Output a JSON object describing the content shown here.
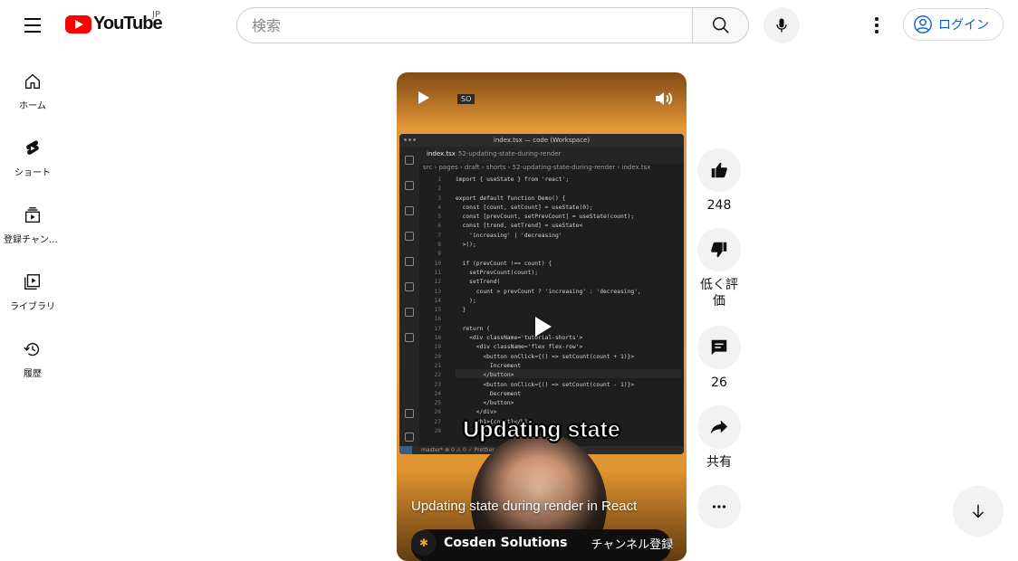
{
  "header": {
    "logo_text": "YouTube",
    "region_code": "JP",
    "search_placeholder": "検索",
    "login_label": "ログイン"
  },
  "guide": {
    "items": [
      {
        "label": "ホーム",
        "icon": "home-icon"
      },
      {
        "label": "ショート",
        "icon": "shorts-icon"
      },
      {
        "label": "登録チャンネル",
        "icon": "subscriptions-icon"
      },
      {
        "label": "ライブラリ",
        "icon": "library-icon"
      },
      {
        "label": "履歴",
        "icon": "history-icon"
      }
    ]
  },
  "player": {
    "so_tag": "SO",
    "overlay_title": "Updating state",
    "video_title": "Updating state during render in React",
    "channel_name": "Cosden Solutions",
    "subscribe_label": "チャンネル登録",
    "editor": {
      "window_title": "index.tsx — code (Workspace)",
      "tab_label": "index.tsx",
      "tab_subtitle": "52-updating-state-during-render",
      "breadcrumb": "src › pages › draft › shorts › 52-updating-state-during-render › index.tsx",
      "status_text": "master*   ⊗ 0 ⚠ 0   ✓ Prettier",
      "line_numbers": [
        "1",
        "2",
        "3",
        "4",
        "5",
        "6",
        "7",
        "8",
        "9",
        "10",
        "11",
        "12",
        "13",
        "14",
        "15",
        "16",
        "17",
        "18",
        "19",
        "20",
        "21",
        "22",
        "23",
        "24",
        "25",
        "26",
        "27",
        "28"
      ],
      "code_lines": [
        "import { useState } from 'react';",
        "",
        "export default function Demo() {",
        "  const [count, setCount] = useState(0);",
        "  const [prevCount, setPrevCount] = useState(count);",
        "  const [trend, setTrend] = useState<",
        "    'increasing' | 'decreasing'",
        "  >();",
        "",
        "  if (prevCount !== count) {",
        "    setPrevCount(count);",
        "    setTrend(",
        "      count > prevCount ? 'increasing' : 'decreasing',",
        "    );",
        "  }",
        "",
        "  return (",
        "    <div className='tutorial-shorts'>",
        "      <div className='flex flex-row'>",
        "        <button onClick={() => setCount(count + 1)}>",
        "          Increment",
        "        </button>",
        "        <button onClick={() => setCount(count - 1)}>",
        "          Decrement",
        "        </button>",
        "      </div>",
        "      <h1>{count}</h1>",
        "      <p>{trend}</p>"
      ]
    }
  },
  "actions": {
    "like_count": "248",
    "dislike_label": "低く評価",
    "comment_count": "26",
    "share_label": "共有"
  },
  "colors": {
    "brand_red": "#ff0000",
    "link_blue": "#065fd4",
    "chip_gray": "#f2f2f2"
  }
}
